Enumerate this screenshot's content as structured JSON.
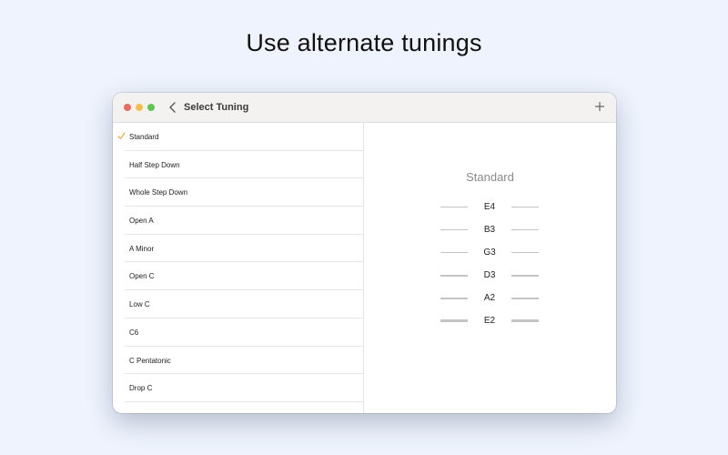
{
  "headline": "Use alternate tunings",
  "window": {
    "title": "Select Tuning"
  },
  "accent_color": "#f0a030",
  "tunings": [
    {
      "label": "Standard",
      "selected": true
    },
    {
      "label": "Half Step Down",
      "selected": false
    },
    {
      "label": "Whole Step Down",
      "selected": false
    },
    {
      "label": "Open A",
      "selected": false
    },
    {
      "label": "A Minor",
      "selected": false
    },
    {
      "label": "Open C",
      "selected": false
    },
    {
      "label": "Low C",
      "selected": false
    },
    {
      "label": "C6",
      "selected": false
    },
    {
      "label": "C Pentatonic",
      "selected": false
    },
    {
      "label": "Drop C",
      "selected": false
    }
  ],
  "detail": {
    "tuning_name": "Standard",
    "strings": [
      {
        "note": "E4"
      },
      {
        "note": "B3"
      },
      {
        "note": "G3"
      },
      {
        "note": "D3"
      },
      {
        "note": "A2"
      },
      {
        "note": "E2"
      }
    ]
  },
  "icons": {
    "back": "chevron-left-icon",
    "add": "plus-icon",
    "check": "checkmark-icon"
  }
}
